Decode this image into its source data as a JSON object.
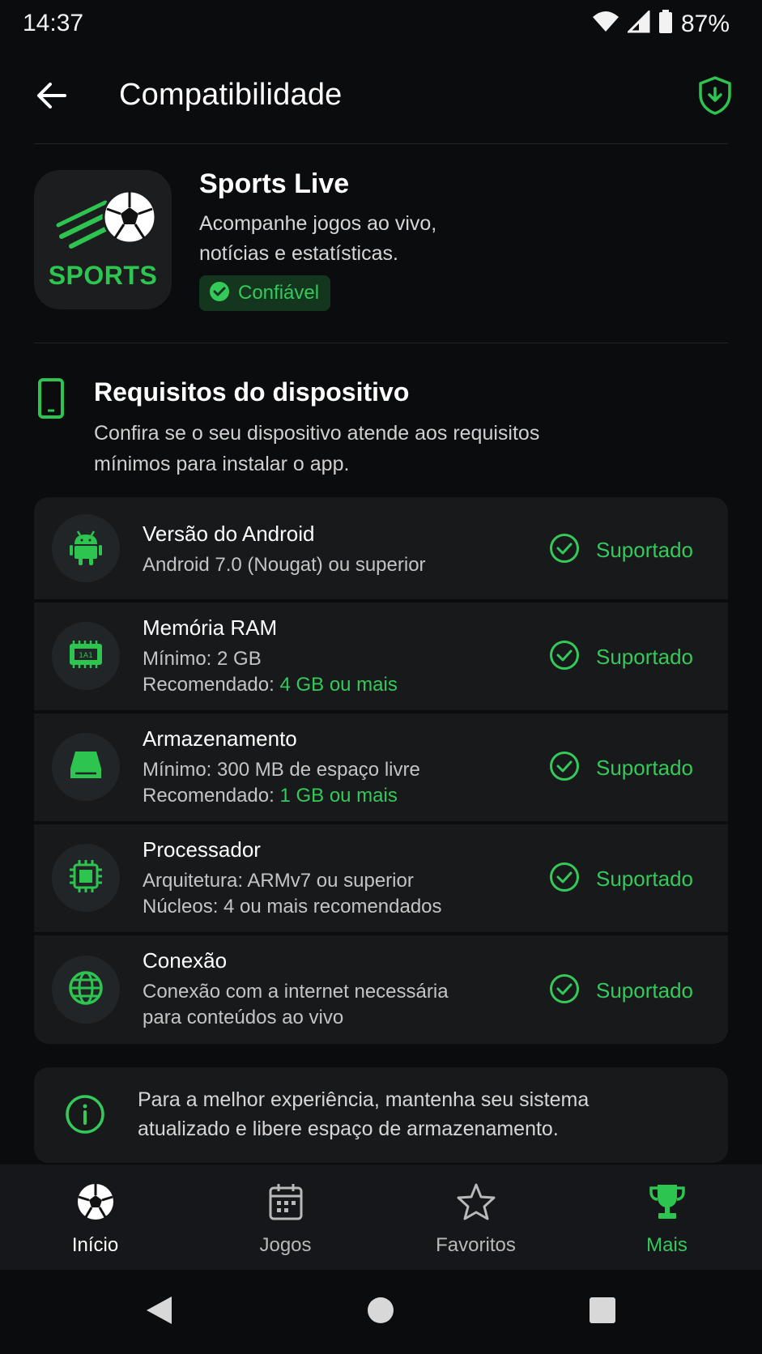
{
  "status_bar": {
    "time": "14:37",
    "battery": "87%"
  },
  "header": {
    "title": "Compatibilidade"
  },
  "app": {
    "logo_text": "SPORTS",
    "name": "Sports Live",
    "description": "Acompanhe jogos ao vivo, notícias e estatísticas.",
    "badge": "Confiável"
  },
  "requirements": {
    "title": "Requisitos do dispositivo",
    "subtitle": "Confira se o seu dispositivo atende aos requisitos mínimos para instalar o app.",
    "items": [
      {
        "icon": "android-icon",
        "title": "Versão do Android",
        "line1": "Android 7.0 (Nougat) ou superior",
        "status": "Suportado"
      },
      {
        "icon": "memory-icon",
        "title": "Memória RAM",
        "line1": "Mínimo: 2 GB",
        "line2_prefix": "Recomendado: ",
        "line2_value": "4 GB ou mais",
        "status": "Suportado"
      },
      {
        "icon": "storage-icon",
        "title": "Armazenamento",
        "line1": "Mínimo: 300 MB de espaço livre",
        "line2_prefix": "Recomendado: ",
        "line2_value": "1 GB ou mais",
        "status": "Suportado"
      },
      {
        "icon": "cpu-icon",
        "title": "Processador",
        "line1": "Arquitetura: ARMv7 ou superior",
        "line2": "Núcleos: 4 ou mais recomendados",
        "status": "Suportado"
      },
      {
        "icon": "globe-icon",
        "title": "Conexão",
        "line1": "Conexão com a internet necessária",
        "line2": "para conteúdos ao vivo",
        "status": "Suportado"
      }
    ]
  },
  "info": {
    "text": "Para a melhor experiência, mantenha seu sistema atualizado e libere espaço de armazenamento."
  },
  "bottom_nav": [
    {
      "label": "Início",
      "icon": "soccer-ball-icon"
    },
    {
      "label": "Jogos",
      "icon": "calendar-icon"
    },
    {
      "label": "Favoritos",
      "icon": "star-icon"
    },
    {
      "label": "Mais",
      "icon": "trophy-icon"
    }
  ],
  "colors": {
    "accent": "#35c95a",
    "background": "#0b0c0d",
    "card": "#17191b"
  }
}
